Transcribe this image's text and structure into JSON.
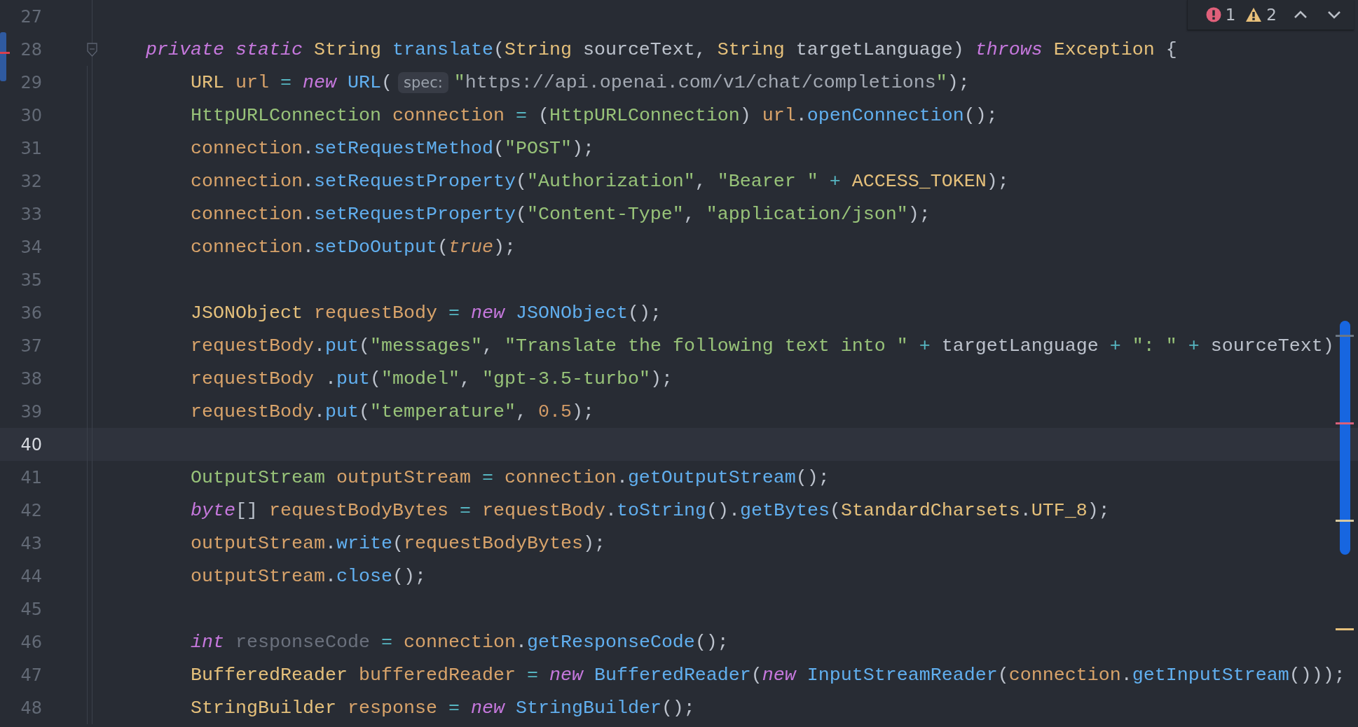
{
  "inspections": {
    "errors": "1",
    "warnings": "2"
  },
  "lines": [
    {
      "number": "27",
      "current": false
    },
    {
      "number": "28",
      "current": false,
      "tokens": [
        {
          "kind": "kw",
          "text": "private static "
        },
        {
          "kind": "type",
          "text": "String "
        },
        {
          "kind": "fn",
          "text": "translate"
        },
        {
          "kind": "punc",
          "text": "("
        },
        {
          "kind": "type",
          "text": "String "
        },
        {
          "kind": "plain",
          "text": "sourceText, "
        },
        {
          "kind": "type",
          "text": "String "
        },
        {
          "kind": "plain",
          "text": "targetLanguage) "
        },
        {
          "kind": "kw",
          "text": "throws "
        },
        {
          "kind": "type",
          "text": "Exception "
        },
        {
          "kind": "punc",
          "text": "{"
        }
      ],
      "children": [
        {
          "number": "29",
          "current": false,
          "tokens": [
            {
              "kind": "type",
              "text": "URL "
            },
            {
              "kind": "var",
              "text": "url "
            },
            {
              "kind": "op",
              "text": "= "
            },
            {
              "kind": "kw",
              "text": "new "
            },
            {
              "kind": "fn",
              "text": "URL"
            },
            {
              "kind": "punc",
              "text": "("
            },
            {
              "kind": "hint",
              "text": "spec:"
            },
            {
              "kind": "str",
              "text": "\""
            },
            {
              "kind": "link",
              "text": "https://api.openai.com/v1/chat/completions"
            },
            {
              "kind": "str",
              "text": "\""
            },
            {
              "kind": "punc",
              "text": ");"
            }
          ]
        },
        {
          "number": "30",
          "current": false,
          "tokens": [
            {
              "kind": "iface",
              "text": "HttpURLConnection "
            },
            {
              "kind": "var",
              "text": "connection "
            },
            {
              "kind": "op",
              "text": "= "
            },
            {
              "kind": "punc",
              "text": "("
            },
            {
              "kind": "iface",
              "text": "HttpURLConnection"
            },
            {
              "kind": "punc",
              "text": ") "
            },
            {
              "kind": "var",
              "text": "url"
            },
            {
              "kind": "punc",
              "text": "."
            },
            {
              "kind": "fn",
              "text": "openConnection"
            },
            {
              "kind": "punc",
              "text": "();"
            }
          ]
        },
        {
          "number": "31",
          "current": false,
          "tokens": [
            {
              "kind": "var",
              "text": "connection"
            },
            {
              "kind": "punc",
              "text": "."
            },
            {
              "kind": "fn",
              "text": "setRequestMethod"
            },
            {
              "kind": "punc",
              "text": "("
            },
            {
              "kind": "str",
              "text": "\"POST\""
            },
            {
              "kind": "punc",
              "text": ");"
            }
          ]
        },
        {
          "number": "32",
          "current": false,
          "tokens": [
            {
              "kind": "var",
              "text": "connection"
            },
            {
              "kind": "punc",
              "text": "."
            },
            {
              "kind": "fn",
              "text": "setRequestProperty"
            },
            {
              "kind": "punc",
              "text": "("
            },
            {
              "kind": "str",
              "text": "\"Authorization\""
            },
            {
              "kind": "punc",
              "text": ", "
            },
            {
              "kind": "str",
              "text": "\"Bearer \" "
            },
            {
              "kind": "op",
              "text": "+ "
            },
            {
              "kind": "const",
              "text": "ACCESS_TOKEN"
            },
            {
              "kind": "punc",
              "text": ");"
            }
          ]
        },
        {
          "number": "33",
          "current": false,
          "tokens": [
            {
              "kind": "var",
              "text": "connection"
            },
            {
              "kind": "punc",
              "text": "."
            },
            {
              "kind": "fn",
              "text": "setRequestProperty"
            },
            {
              "kind": "punc",
              "text": "("
            },
            {
              "kind": "str",
              "text": "\"Content-Type\""
            },
            {
              "kind": "punc",
              "text": ", "
            },
            {
              "kind": "str",
              "text": "\"application/json\""
            },
            {
              "kind": "punc",
              "text": ");"
            }
          ]
        },
        {
          "number": "34",
          "current": false,
          "tokens": [
            {
              "kind": "var",
              "text": "connection"
            },
            {
              "kind": "punc",
              "text": "."
            },
            {
              "kind": "fn",
              "text": "setDoOutput"
            },
            {
              "kind": "punc",
              "text": "("
            },
            {
              "kind": "bool",
              "text": "true"
            },
            {
              "kind": "punc",
              "text": ");"
            }
          ]
        },
        {
          "number": "35",
          "current": false
        },
        {
          "number": "36",
          "current": false,
          "tokens": [
            {
              "kind": "type",
              "text": "JSONObject "
            },
            {
              "kind": "var",
              "text": "requestBody "
            },
            {
              "kind": "op",
              "text": "= "
            },
            {
              "kind": "kw",
              "text": "new "
            },
            {
              "kind": "fn",
              "text": "JSONObject"
            },
            {
              "kind": "punc",
              "text": "();"
            }
          ]
        },
        {
          "number": "37",
          "current": false,
          "tokens": [
            {
              "kind": "var",
              "text": "requestBody"
            },
            {
              "kind": "punc",
              "text": "."
            },
            {
              "kind": "fn",
              "text": "put"
            },
            {
              "kind": "punc",
              "text": "("
            },
            {
              "kind": "str",
              "text": "\"messages\""
            },
            {
              "kind": "punc",
              "text": ", "
            },
            {
              "kind": "str",
              "text": "\"Translate the following text into \" "
            },
            {
              "kind": "op",
              "text": "+ "
            },
            {
              "kind": "plain",
              "text": "targetLanguage "
            },
            {
              "kind": "op",
              "text": "+ "
            },
            {
              "kind": "str",
              "text": "\": \" "
            },
            {
              "kind": "op",
              "text": "+ "
            },
            {
              "kind": "plain",
              "text": "sourceText)"
            }
          ]
        },
        {
          "number": "38",
          "current": false,
          "tokens": [
            {
              "kind": "var",
              "text": "requestBody "
            },
            {
              "kind": "punc",
              "text": "."
            },
            {
              "kind": "fn",
              "text": "put"
            },
            {
              "kind": "punc",
              "text": "("
            },
            {
              "kind": "str",
              "text": "\"model\""
            },
            {
              "kind": "punc",
              "text": ", "
            },
            {
              "kind": "str",
              "text": "\"gpt-3.5-turbo\""
            },
            {
              "kind": "punc",
              "text": ");"
            }
          ]
        },
        {
          "number": "39",
          "current": false,
          "tokens": [
            {
              "kind": "var",
              "text": "requestBody"
            },
            {
              "kind": "punc",
              "text": "."
            },
            {
              "kind": "fn",
              "text": "put"
            },
            {
              "kind": "punc",
              "text": "("
            },
            {
              "kind": "str",
              "text": "\"temperature\""
            },
            {
              "kind": "punc",
              "text": ", "
            },
            {
              "kind": "num",
              "text": "0.5"
            },
            {
              "kind": "punc",
              "text": ");"
            }
          ]
        },
        {
          "number": "40",
          "current": true
        },
        {
          "number": "41",
          "current": false,
          "tokens": [
            {
              "kind": "iface",
              "text": "OutputStream "
            },
            {
              "kind": "var",
              "text": "outputStream "
            },
            {
              "kind": "op",
              "text": "= "
            },
            {
              "kind": "var",
              "text": "connection"
            },
            {
              "kind": "punc",
              "text": "."
            },
            {
              "kind": "fn",
              "text": "getOutputStream"
            },
            {
              "kind": "punc",
              "text": "();"
            }
          ]
        },
        {
          "number": "42",
          "current": false,
          "tokens": [
            {
              "kind": "kw",
              "text": "byte"
            },
            {
              "kind": "punc",
              "text": "[] "
            },
            {
              "kind": "var",
              "text": "requestBodyBytes "
            },
            {
              "kind": "op",
              "text": "= "
            },
            {
              "kind": "var",
              "text": "requestBody"
            },
            {
              "kind": "punc",
              "text": "."
            },
            {
              "kind": "fn",
              "text": "toString"
            },
            {
              "kind": "punc",
              "text": "()."
            },
            {
              "kind": "fn",
              "text": "getBytes"
            },
            {
              "kind": "punc",
              "text": "("
            },
            {
              "kind": "type",
              "text": "StandardCharsets"
            },
            {
              "kind": "punc",
              "text": "."
            },
            {
              "kind": "const",
              "text": "UTF_8"
            },
            {
              "kind": "punc",
              "text": ");"
            }
          ]
        },
        {
          "number": "43",
          "current": false,
          "tokens": [
            {
              "kind": "var",
              "text": "outputStream"
            },
            {
              "kind": "punc",
              "text": "."
            },
            {
              "kind": "fn",
              "text": "write"
            },
            {
              "kind": "punc",
              "text": "("
            },
            {
              "kind": "var",
              "text": "requestBodyBytes"
            },
            {
              "kind": "punc",
              "text": ");"
            }
          ]
        },
        {
          "number": "44",
          "current": false,
          "tokens": [
            {
              "kind": "var",
              "text": "outputStream"
            },
            {
              "kind": "punc",
              "text": "."
            },
            {
              "kind": "fn",
              "text": "close"
            },
            {
              "kind": "punc",
              "text": "();"
            }
          ]
        },
        {
          "number": "45",
          "current": false
        },
        {
          "number": "46",
          "current": false,
          "tokens": [
            {
              "kind": "kw",
              "text": "int "
            },
            {
              "kind": "unused",
              "text": "responseCode "
            },
            {
              "kind": "op",
              "text": "= "
            },
            {
              "kind": "var",
              "text": "connection"
            },
            {
              "kind": "punc",
              "text": "."
            },
            {
              "kind": "fn",
              "text": "getResponseCode"
            },
            {
              "kind": "punc",
              "text": "();"
            }
          ]
        },
        {
          "number": "47",
          "current": false,
          "tokens": [
            {
              "kind": "type",
              "text": "BufferedReader "
            },
            {
              "kind": "var",
              "text": "bufferedReader "
            },
            {
              "kind": "op",
              "text": "= "
            },
            {
              "kind": "kw",
              "text": "new "
            },
            {
              "kind": "fn",
              "text": "BufferedReader"
            },
            {
              "kind": "punc",
              "text": "("
            },
            {
              "kind": "kw",
              "text": "new "
            },
            {
              "kind": "fn",
              "text": "InputStreamReader"
            },
            {
              "kind": "punc",
              "text": "("
            },
            {
              "kind": "var",
              "text": "connection"
            },
            {
              "kind": "punc",
              "text": "."
            },
            {
              "kind": "fn",
              "text": "getInputStream"
            },
            {
              "kind": "punc",
              "text": "()));"
            }
          ]
        },
        {
          "number": "48",
          "current": false,
          "tokens": [
            {
              "kind": "type",
              "text": "StringBuilder "
            },
            {
              "kind": "var",
              "text": "response "
            },
            {
              "kind": "op",
              "text": "= "
            },
            {
              "kind": "kw",
              "text": "new "
            },
            {
              "kind": "fn",
              "text": "StringBuilder"
            },
            {
              "kind": "punc",
              "text": "();"
            }
          ]
        }
      ]
    }
  ]
}
